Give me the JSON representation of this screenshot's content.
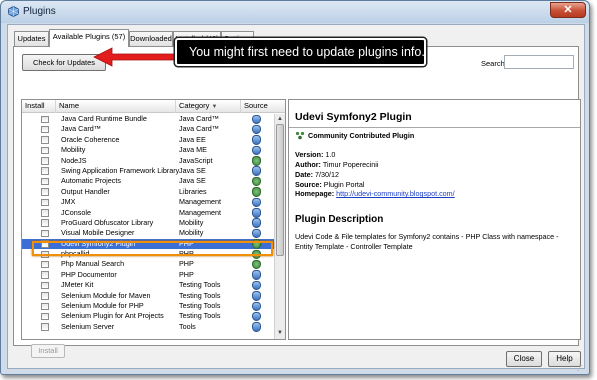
{
  "window": {
    "title": "Plugins",
    "close_glyph": "✕"
  },
  "tabs": [
    {
      "label": "Updates",
      "selected": false
    },
    {
      "label": "Available Plugins (57)",
      "selected": true
    },
    {
      "label": "Downloaded",
      "selected": false
    },
    {
      "label": "Installed (46)",
      "selected": false
    },
    {
      "label": "Settings",
      "selected": false
    }
  ],
  "toolbar": {
    "check_updates_label": "Check for Updates",
    "search_label": "Search:",
    "search_value": ""
  },
  "callout": {
    "text": "You might first need to update plugins info.",
    "arrow_color": "#e31d1d"
  },
  "table": {
    "headers": {
      "install": "Install",
      "name": "Name",
      "category": "Category",
      "sort_glyph": "▼",
      "source": "Source"
    },
    "rows": [
      {
        "name": "Java Card Runtime Bundle",
        "category": "Java Card™",
        "source_icon": "netbeans-source-icon"
      },
      {
        "name": "Java Card™",
        "category": "Java Card™",
        "source_icon": "netbeans-source-icon"
      },
      {
        "name": "Oracle Coherence",
        "category": "Java EE",
        "source_icon": "netbeans-source-icon"
      },
      {
        "name": "Mobility",
        "category": "Java ME",
        "source_icon": "netbeans-source-icon"
      },
      {
        "name": "NodeJS",
        "category": "JavaScript",
        "source_icon": "community-source-icon"
      },
      {
        "name": "Swing Application Framework Library",
        "category": "Java SE",
        "source_icon": "netbeans-source-icon"
      },
      {
        "name": "Automatic Projects",
        "category": "Java SE",
        "source_icon": "community-source-icon"
      },
      {
        "name": "Output Handler",
        "category": "Libraries",
        "source_icon": "community-source-icon"
      },
      {
        "name": "JMX",
        "category": "Management",
        "source_icon": "netbeans-source-icon"
      },
      {
        "name": "JConsole",
        "category": "Management",
        "source_icon": "netbeans-source-icon"
      },
      {
        "name": "ProGuard Obfuscator Library",
        "category": "Mobility",
        "source_icon": "netbeans-source-icon"
      },
      {
        "name": "Visual Mobile Designer",
        "category": "Mobility",
        "source_icon": "netbeans-source-icon"
      },
      {
        "name": "Udevi Symfony2 Plugin",
        "category": "PHP",
        "source_icon": "community-source-icon",
        "selected": true
      },
      {
        "name": "phpcallid",
        "category": "PHP",
        "source_icon": "community-source-icon"
      },
      {
        "name": "Php Manual Search",
        "category": "PHP",
        "source_icon": "community-source-icon"
      },
      {
        "name": "PHP Documentor",
        "category": "PHP",
        "source_icon": "netbeans-source-icon"
      },
      {
        "name": "JMeter Kit",
        "category": "Testing Tools",
        "source_icon": "netbeans-source-icon"
      },
      {
        "name": "Selenium Module for Maven",
        "category": "Testing Tools",
        "source_icon": "netbeans-source-icon"
      },
      {
        "name": "Selenium Module for PHP",
        "category": "Testing Tools",
        "source_icon": "netbeans-source-icon"
      },
      {
        "name": "Selenium Plugin for Ant Projects",
        "category": "Testing Tools",
        "source_icon": "netbeans-source-icon"
      },
      {
        "name": "Selenium Server",
        "category": "Tools",
        "source_icon": "netbeans-source-icon"
      }
    ]
  },
  "install_button_label": "Install",
  "details": {
    "title": "Udevi Symfony2 Plugin",
    "badge_label": "Community Contributed Plugin",
    "version_label": "Version:",
    "version": "1.0",
    "author_label": "Author:",
    "author": "Timur Poperecinii",
    "date_label": "Date:",
    "date": "7/30/12",
    "source_label": "Source:",
    "source": "Plugin Portal",
    "homepage_label": "Homepage:",
    "homepage": "http://udevi-community.blogspot.com/",
    "description_title": "Plugin Description",
    "description": "Udevi Code & File templates for Symfony2 contains - PHP Class with namespace - Entity Template - Controller Template"
  },
  "footer": {
    "close_label": "Close",
    "help_label": "Help"
  },
  "colors": {
    "selection": "#3b6fd6",
    "highlight_border": "#f0900a",
    "link": "#1a3fc7"
  }
}
